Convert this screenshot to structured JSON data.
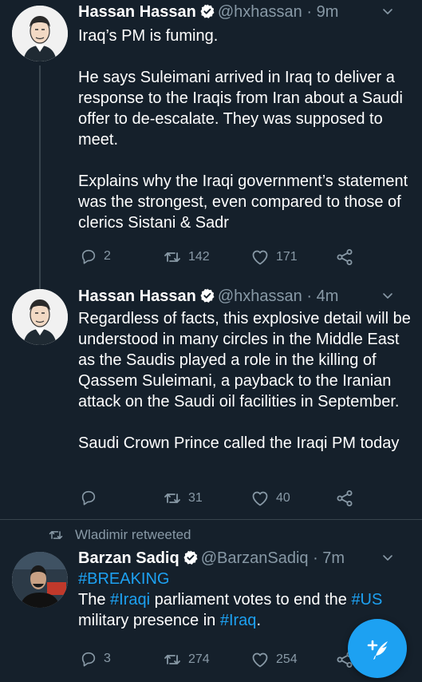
{
  "tweets": [
    {
      "name": "Hassan Hassan",
      "handle": "@hxhassan",
      "time": "· 9m",
      "lines": [
        "Iraq’s PM is fuming.",
        "",
        "He says Suleimani arrived in Iraq to deliver a response to the Iraqis from Iran about a Saudi offer to de-escalate. They was supposed to meet.",
        "",
        "Explains why the Iraqi government’s statement was the strongest, even compared to those of clerics Sistani & Sadr"
      ],
      "replies": "2",
      "retweets": "142",
      "likes": "171"
    },
    {
      "name": "Hassan Hassan",
      "handle": "@hxhassan",
      "time": "· 4m",
      "lines": [
        "Regardless of facts, this explosive detail will be understood in many circles in the Middle East as the Saudis played a role in the killing of Qassem Suleimani, a payback to the Iranian attack on the Saudi oil facilities in September.",
        "",
        "Saudi Crown Prince called the Iraqi PM today"
      ],
      "replies": "",
      "retweets": "31",
      "likes": "40"
    },
    {
      "retweeted_by": "Wladimir retweeted",
      "name": "Barzan Sadiq",
      "handle": "@BarzanSadiq",
      "time": "· 7m",
      "hashtag_line": "#BREAKING",
      "text_parts": {
        "a": "The ",
        "b": "#Iraqi",
        "c": " parliament votes to end the ",
        "d": "#US",
        "e": "military presence in ",
        "f": "#Iraq",
        "g": "."
      },
      "replies": "3",
      "retweets": "274",
      "likes": "254"
    }
  ],
  "icons": {
    "reply": "reply-icon",
    "retweet": "retweet-icon",
    "like": "heart-icon",
    "share": "share-icon",
    "compose": "compose-tweet-icon",
    "verified": "verified-badge-icon",
    "more": "chevron-down-icon"
  },
  "colors": {
    "background": "#15202b",
    "secondary_text": "#8899a6",
    "accent": "#1da1f2",
    "divider": "#38444d"
  }
}
